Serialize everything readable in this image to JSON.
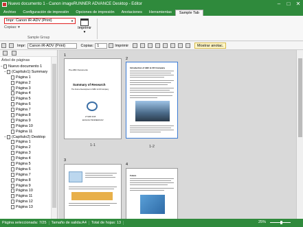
{
  "window": {
    "title": "Nuevo documento 1 - Canon imageRUNNER ADVANCE Desktop - Editor",
    "controls": [
      "–",
      "□",
      "✕"
    ]
  },
  "menu": {
    "tabs": [
      {
        "label": "Archivo"
      },
      {
        "label": "Configuración de impresión"
      },
      {
        "label": "Opciones de impresión"
      },
      {
        "label": "Anotaciones"
      },
      {
        "label": "Herramientas"
      },
      {
        "label": "Sample Tab"
      }
    ],
    "active_tab": "Sample Tab"
  },
  "ribbon": {
    "printer_label": "Impr:",
    "printer_value": "Canon iR-ADV (Print)",
    "copies_label": "Copias:",
    "print_label": "Imprimir",
    "group_label": "Sample Group"
  },
  "toolbar": {
    "printer_label": "Impr:",
    "printer_value": "Canon iR-ADV (Print)",
    "copies_label": "Copias:",
    "copies_value": "1",
    "print_label": "Imprimir",
    "show_annotations_label": "Mostrar anotac."
  },
  "left_panel": {
    "tree_title": "Árbol de páginas",
    "root": "Nuevo documento 1",
    "chapters": [
      {
        "label": "(Capítulo1) Summary",
        "pages": [
          "Página 1",
          "Página 2",
          "Página 3",
          "Página 4",
          "Página 5",
          "Página 6",
          "Página 7",
          "Página 8",
          "Página 9",
          "Página 10",
          "Página 11"
        ]
      },
      {
        "label": "(Capítulo2) Desktop",
        "pages": [
          "Página 1",
          "Página 2",
          "Página 3",
          "Página 4",
          "Página 5",
          "Página 6",
          "Página 7",
          "Página 8",
          "Página 9",
          "Página 10",
          "Página 11",
          "Página 12",
          "Página 13"
        ]
      }
    ]
  },
  "main": {
    "pages": [
      {
        "num": "1",
        "caption": "1-1"
      },
      {
        "num": "2",
        "caption": "1-2"
      },
      {
        "num": "3",
        "caption": ""
      },
      {
        "num": "4",
        "caption": ""
      }
    ],
    "page1_title": "Summary of Research",
    "page1_sub": "The Future Development of ABC & CD Company",
    "page1_date": "27 MAR 2015",
    "page1_dept": "ECOLOGY BUSINESS DIV",
    "page1_header": "Pre-ABC Documents",
    "page2_header": "Introduction of ABC & CD Company",
    "page4_header": "Future"
  },
  "status": {
    "selected": "Página seleccionada: 7/25",
    "output_size": "Tamaño de salida:A4",
    "total_sheets": "Total de hojas: 13",
    "zoom": "25%"
  },
  "colors": {
    "accent": "#2f8a3c",
    "highlight": "#e02020",
    "selection": "#3a7bd5"
  }
}
